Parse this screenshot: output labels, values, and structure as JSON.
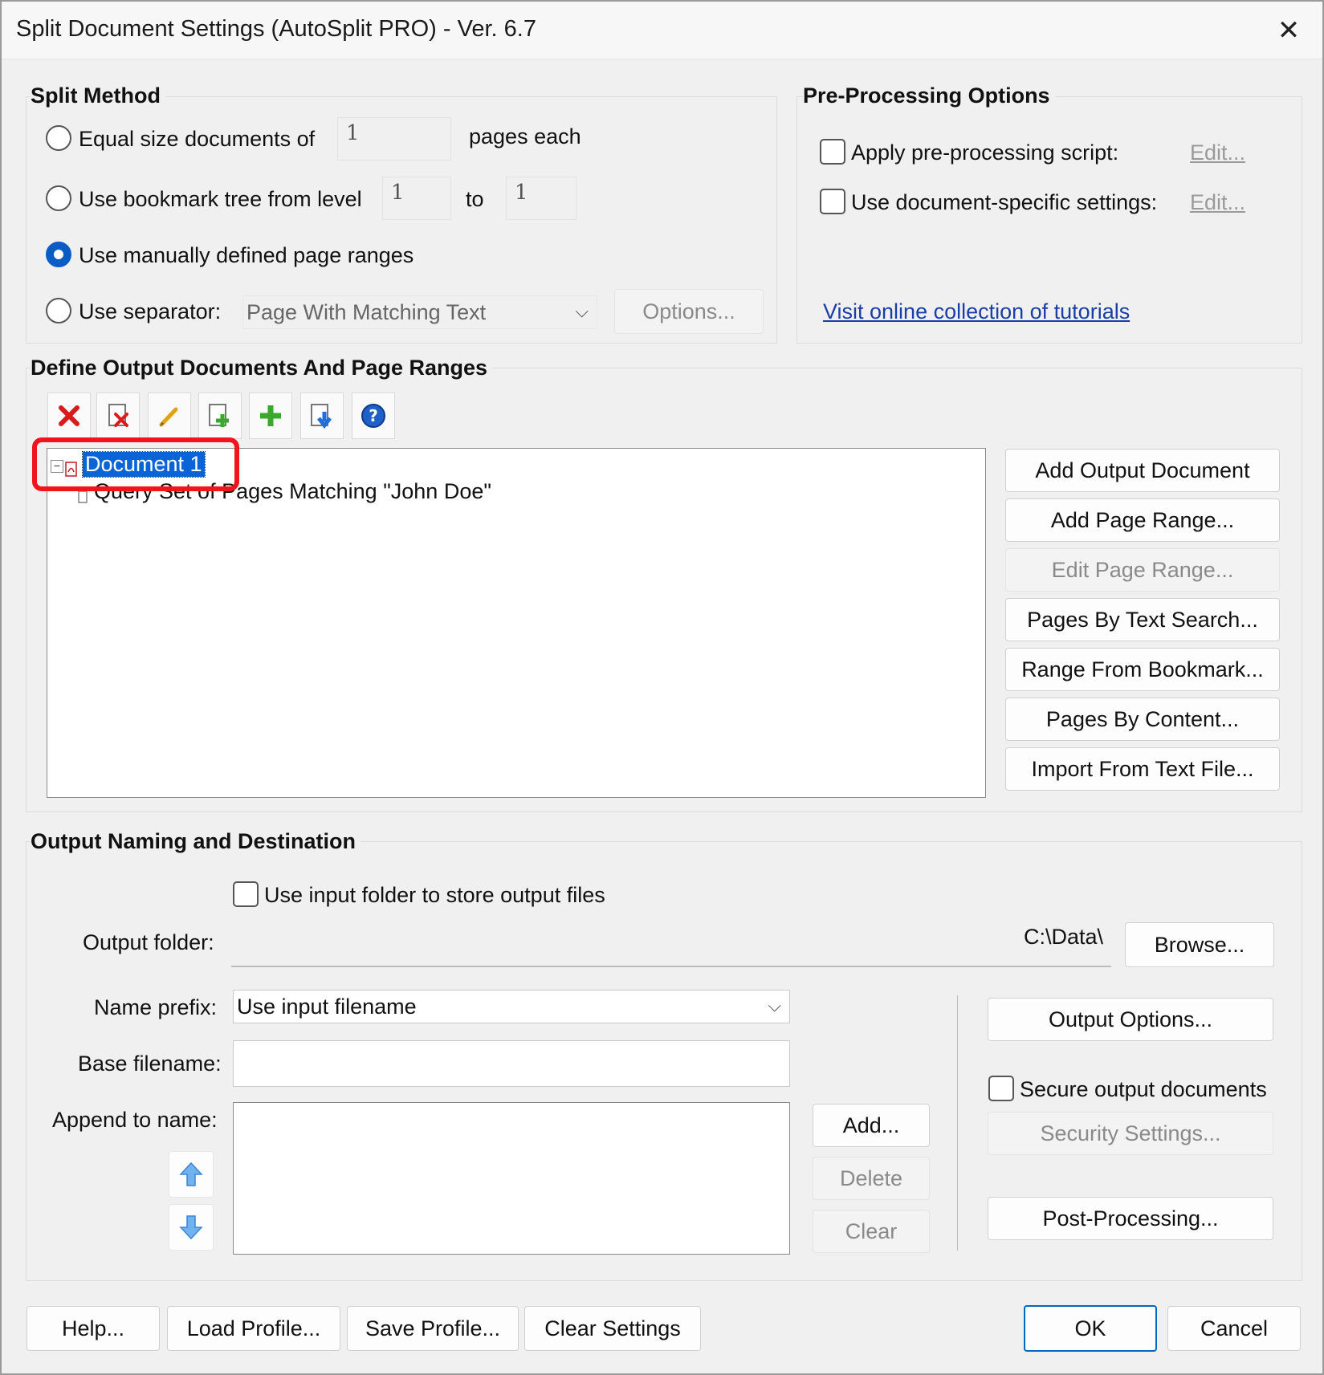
{
  "window": {
    "title": "Split Document Settings (AutoSplit PRO) - Ver. 6.7",
    "close_glyph": "✕"
  },
  "split_method": {
    "title": "Split Method",
    "equal_size": {
      "label": "Equal size documents of",
      "value": "1",
      "suffix": "pages each",
      "checked": false
    },
    "bookmark": {
      "label": "Use bookmark tree from level",
      "from": "1",
      "to_label": "to",
      "to": "1",
      "checked": false
    },
    "manual": {
      "label": "Use manually defined page ranges",
      "checked": true
    },
    "separator": {
      "label": "Use separator:",
      "selected": "Page With Matching Text",
      "options_button": "Options...",
      "checked": false
    }
  },
  "preprocessing": {
    "title": "Pre-Processing Options",
    "script": {
      "label": "Apply pre-processing script:",
      "edit": "Edit...",
      "checked": false
    },
    "doc_specific": {
      "label": "Use document-specific settings:",
      "edit": "Edit...",
      "checked": false
    },
    "tutorials_link": "Visit online collection of tutorials"
  },
  "define_output": {
    "title": "Define Output Documents And Page Ranges",
    "tree": {
      "document": "Document 1",
      "child": "Query Set of Pages Matching \"John Doe\""
    },
    "buttons": {
      "add_output_document": "Add Output Document",
      "add_page_range": "Add Page Range...",
      "edit_page_range": "Edit Page Range...",
      "pages_by_text_search": "Pages By Text Search...",
      "range_from_bookmark": "Range From Bookmark...",
      "pages_by_content": "Pages By Content...",
      "import_from_text_file": "Import From Text File..."
    }
  },
  "output_naming": {
    "title": "Output Naming and Destination",
    "use_input_folder": {
      "label": "Use input folder to store output files",
      "checked": false
    },
    "output_folder": {
      "label": "Output folder:",
      "value": "C:\\Data\\",
      "browse": "Browse..."
    },
    "name_prefix": {
      "label": "Name prefix:",
      "selected": "Use input filename"
    },
    "base_filename": {
      "label": "Base filename:",
      "value": ""
    },
    "append_to_name": {
      "label": "Append to name:",
      "add": "Add...",
      "delete": "Delete",
      "clear": "Clear"
    },
    "output_options": "Output Options...",
    "secure": {
      "label": "Secure output documents",
      "checked": false
    },
    "security_settings": "Security Settings...",
    "post_processing": "Post-Processing..."
  },
  "footer": {
    "help": "Help...",
    "load_profile": "Load Profile...",
    "save_profile": "Save Profile...",
    "clear_settings": "Clear Settings",
    "ok": "OK",
    "cancel": "Cancel"
  },
  "colors": {
    "accent": "#0a5cc2",
    "highlight_annotation": "#f2141c",
    "link": "#1a3ea8"
  }
}
